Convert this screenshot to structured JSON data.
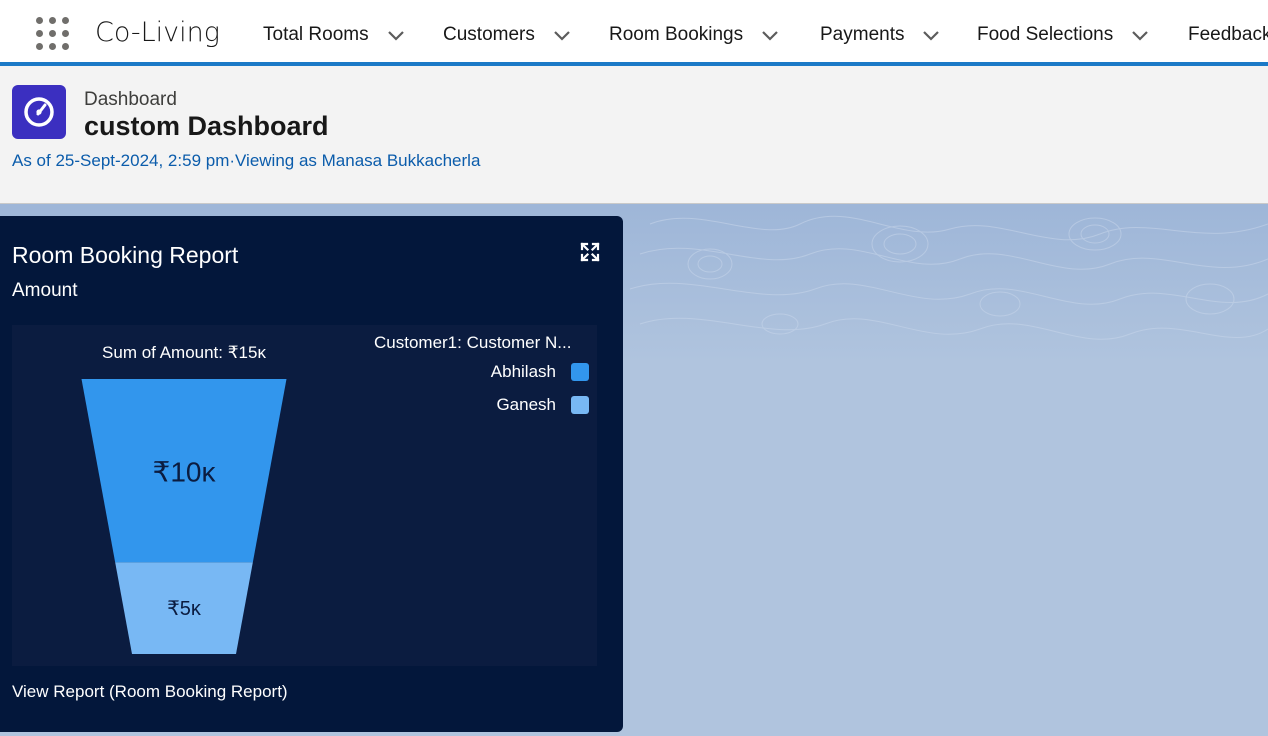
{
  "app": {
    "name": "Co-Living"
  },
  "nav": {
    "items": [
      {
        "label": "Total Rooms"
      },
      {
        "label": "Customers"
      },
      {
        "label": "Room Bookings"
      },
      {
        "label": "Payments"
      },
      {
        "label": "Food Selections"
      },
      {
        "label": "Feedback"
      }
    ]
  },
  "header": {
    "breadcrumb": "Dashboard",
    "title": "custom Dashboard",
    "as_of": "As of 25-Sept-2024, 2:59 pm·Viewing as Manasa Bukkacherla"
  },
  "card": {
    "title": "Room Booking Report",
    "subtitle": "Amount",
    "view_report": "View Report (Room Booking Report)"
  },
  "colors": {
    "nav_accent": "#1b7ac7",
    "dashboard_icon": "#3b2fc0",
    "card_bg": "#03173b",
    "series_abhilash": "#3296ed",
    "series_ganesh": "#78b8f4"
  },
  "chart_data": {
    "type": "funnel",
    "title": "Sum of Amount: ₹15ĸ",
    "legend_title": "Customer1: Customer  N...",
    "legend_position": "top-right",
    "series": [
      {
        "name": "Abhilash",
        "value": 10000,
        "label": "₹10ĸ",
        "color": "#3296ed"
      },
      {
        "name": "Ganesh",
        "value": 5000,
        "label": "₹5ĸ",
        "color": "#78b8f4"
      }
    ],
    "total": 15000
  }
}
